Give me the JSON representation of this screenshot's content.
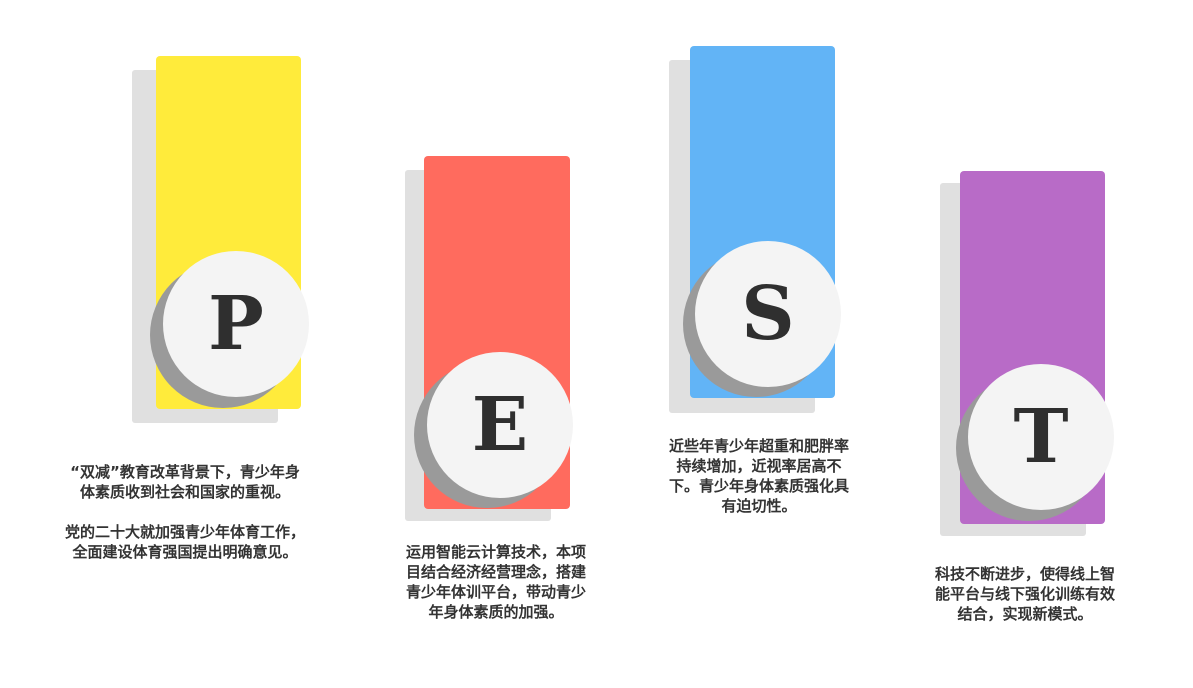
{
  "columns": [
    {
      "letter": "P",
      "color": "#FFEB3B",
      "paragraphs": [
        "“双减”教育改革背景下，青少年身\n体素质收到社会和国家的重视。",
        "党的二十大就加强青少年体育工作，\n全面建设体育强国提出明确意见。"
      ]
    },
    {
      "letter": "E",
      "color": "#FF6B5E",
      "paragraphs": [
        "运用智能云计算技术，本项\n目结合经济经营理念，搭建\n青少年体训平台，带动青少\n年身体素质的加强。"
      ]
    },
    {
      "letter": "S",
      "color": "#62B4F6",
      "paragraphs": [
        "近些年青少年超重和肥胖率\n持续增加，近视率居高不\n下。青少年身体素质强化具\n有迫切性。"
      ]
    },
    {
      "letter": "T",
      "color": "#B86BC7",
      "paragraphs": [
        "科技不断进步，使得线上智\n能平台与线下强化训练有效\n结合，实现新模式。"
      ]
    }
  ]
}
